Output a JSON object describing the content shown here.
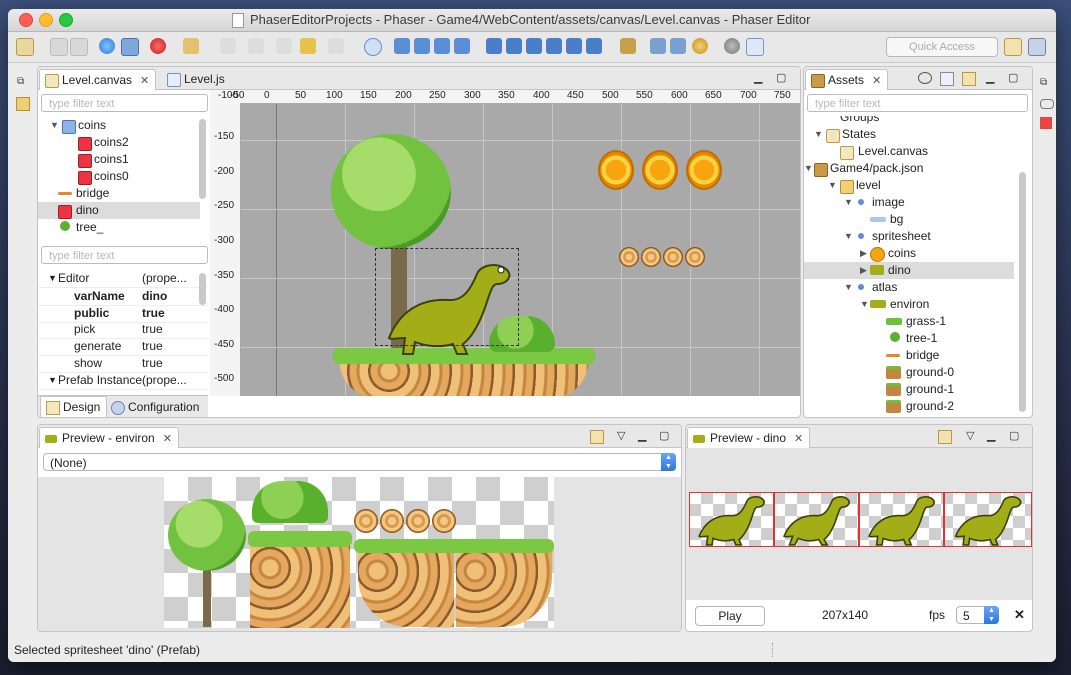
{
  "window": {
    "title": "PhaserEditorProjects - Phaser - Game4/WebContent/assets/canvas/Level.canvas - Phaser Editor"
  },
  "toolbar": {
    "quick_access": "Quick Access"
  },
  "editor": {
    "tabs": [
      {
        "label": "Level.canvas",
        "close": "✕"
      },
      {
        "label": "Level.js"
      }
    ],
    "outline_filter": "type filter text",
    "outline": [
      {
        "label": "coins",
        "expanded": true
      },
      {
        "label": "coins2"
      },
      {
        "label": "coins1"
      },
      {
        "label": "coins0"
      },
      {
        "label": "bridge"
      },
      {
        "label": "dino",
        "selected": true
      },
      {
        "label": "tree_"
      }
    ],
    "props_filter": "type filter text",
    "props": [
      {
        "key": "Editor",
        "value": "(prope..."
      },
      {
        "key": "varName",
        "value": "dino"
      },
      {
        "key": "public",
        "value": "true"
      },
      {
        "key": "pick",
        "value": "true"
      },
      {
        "key": "generate",
        "value": "true"
      },
      {
        "key": "show",
        "value": "true"
      },
      {
        "key": "Prefab Instance",
        "value": "(prope..."
      }
    ],
    "bottom_tabs": [
      "Design",
      "Configuration"
    ],
    "ruler_x": [
      "-100",
      "-50",
      "0",
      "50",
      "100",
      "150",
      "200",
      "250",
      "300",
      "350",
      "400",
      "450",
      "500",
      "550",
      "600",
      "650",
      "700",
      "750"
    ],
    "ruler_y": [
      "-150",
      "-200",
      "-250",
      "-300",
      "-350",
      "-400",
      "-450",
      "-500"
    ]
  },
  "assets": {
    "tab_label": "Assets",
    "close": "✕",
    "filter": "type filter text",
    "tree": [
      {
        "label": "Groups"
      },
      {
        "label": "States"
      },
      {
        "label": "Level.canvas"
      },
      {
        "label": "Game4/pack.json"
      },
      {
        "label": "level"
      },
      {
        "label": "image"
      },
      {
        "label": "bg"
      },
      {
        "label": "spritesheet"
      },
      {
        "label": "coins"
      },
      {
        "label": "dino",
        "selected": true
      },
      {
        "label": "atlas"
      },
      {
        "label": "environ"
      },
      {
        "label": "grass-1"
      },
      {
        "label": "tree-1"
      },
      {
        "label": "bridge"
      },
      {
        "label": "ground-0"
      },
      {
        "label": "ground-1"
      },
      {
        "label": "ground-2"
      }
    ]
  },
  "preview_environ": {
    "tab_label": "Preview - environ",
    "close": "✕",
    "combo_value": "(None)"
  },
  "preview_dino": {
    "tab_label": "Preview - dino",
    "close": "✕",
    "play": "Play",
    "size": "207x140",
    "fps_label": "fps",
    "fps_value": "5",
    "clear": "✕"
  },
  "status": {
    "text": "Selected spritesheet 'dino' (Prefab)"
  }
}
